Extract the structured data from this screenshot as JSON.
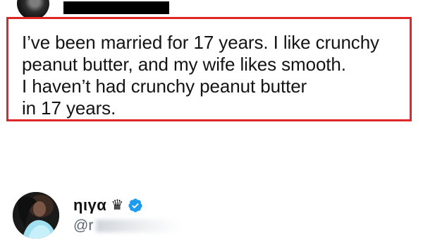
{
  "original_post": {
    "author_redacted": true
  },
  "quoted_tweet": {
    "lines": [
      "I’ve been married for 17 years. I like crunchy",
      "peanut butter, and my wife likes smooth.",
      "I haven’t had crunchy peanut butter",
      "in 17 years."
    ],
    "highlight_color": "#e02727"
  },
  "profile": {
    "display_name": "ηιγα",
    "crown_glyph": "♛",
    "verified_color": "#1d9bf0",
    "handle_visible": "@r"
  }
}
